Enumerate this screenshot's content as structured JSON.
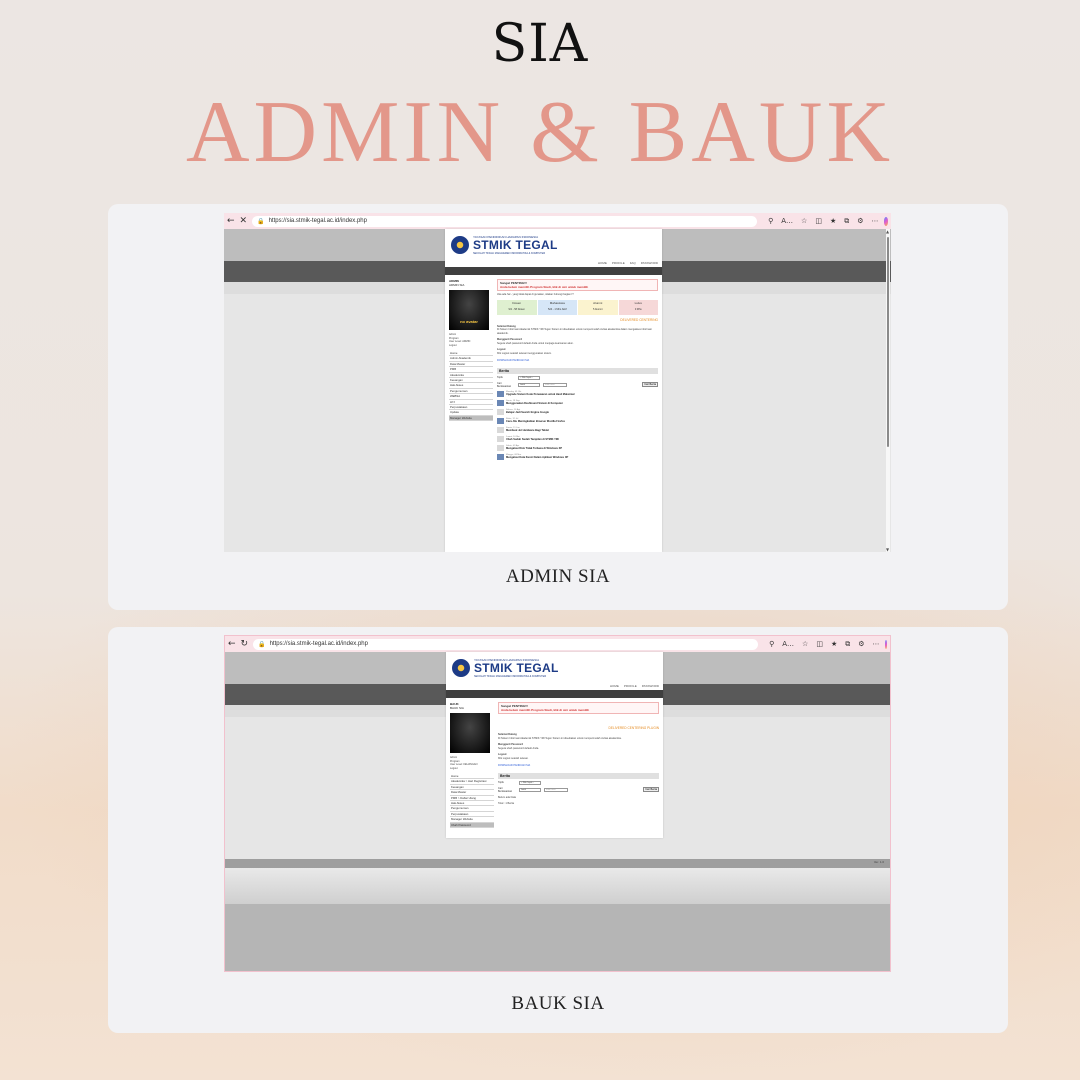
{
  "heading": {
    "small": "SIA",
    "large": "ADMIN & BAUK"
  },
  "colors": {
    "accent": "#e3978a",
    "card": "#f2f2f4",
    "tab_bar": "#f9e3e8"
  },
  "panels": [
    {
      "caption": "ADMIN SIA",
      "browser": {
        "url": "https://sia.stmik-tegal.ac.id/index.php",
        "toolbar_icons": [
          "back-icon",
          "close-icon",
          "lock-icon",
          "zoom-icon",
          "read-aloud-icon",
          "favorite-icon",
          "split-screen-icon",
          "favorites-bar-icon",
          "collections-icon",
          "extensions-icon",
          "more-icon",
          "copilot-icon"
        ]
      },
      "site": {
        "foundation": "YAYASAN PENDIDIKAN HARAPAN INDONESIA",
        "name": "STMIK TEGAL",
        "subtitle": "SEKOLAH TINGGI MANAJEMEN INFORMATIKA & KOMPUTER",
        "nav": [
          "HOME",
          "PROFILE",
          "FAQ",
          "PASSWORD"
        ],
        "user": {
          "role": "ADMIN",
          "name": "ADMIN SIA",
          "avatar_label": "no avatar",
          "meta": [
            "Admin",
            "Program",
            "User Level: ADMIN",
            "Logout"
          ]
        },
        "menu": [
          "Home",
          "Admin Akademik",
          "Data Master",
          "PMB",
          "Akademika",
          "Keuangan",
          "Hak Akses",
          "Pengumuman",
          "WEBSA",
          "LPJ",
          "Perpustakaan",
          "Update",
          "Manager Website"
        ],
        "alert_title": "Sangat PENTING!!!",
        "alert_text": "Anda belum memilih Program Studi, klik di sini untuk memilih",
        "notice": "Jika ada hal - yang tidak dapat di gunakan, silakan hubungi bagian IT",
        "stats": [
          {
            "label": "Dosen",
            "value": "9/2 - 58 Dosen",
            "color": "#dff0d0"
          },
          {
            "label": "Mahasiswa",
            "value": "524 - 1 Mhs Aktif",
            "color": "#d6e6f7"
          },
          {
            "label": "Alumni",
            "value": "5 Alumni",
            "color": "#fbf3cf"
          },
          {
            "label": "Lulus",
            "value": "0 Mhs",
            "color": "#f6d8d8"
          }
        ],
        "rss": "DELIVERED CENTERING",
        "sections": [
          {
            "title": "Selamat Datang",
            "text": "Di Sistem Informasi Akademik STMIK YMI Tegal. Sistem ini disediakan untuk mempermudah civitas akademika dalam mengakses informasi akademik."
          },
          {
            "title": "Mengganti Password",
            "text": "Segera ubah password default Anda untuk menjaga keamanan akun."
          },
          {
            "title": "Logout",
            "text": "Klik Logout setelah selesai menggunakan sistem."
          }
        ],
        "download": "DOWNLOAD PANDUAN SIA",
        "news_title": "Berita",
        "filter": {
          "label1": "Topik",
          "label2": "Cari Berdasarkan",
          "select1": "-- Pilih Topik --",
          "select2": "Judul",
          "placeholder": "Kata Kunci",
          "button": "Cari Berita"
        },
        "news": [
          {
            "date": "Monday, 09 Okt",
            "title": "Upgrade Sistem Kode Penawaran untuk Hasil Maksimal"
          },
          {
            "date": "Senin, 18 Sep",
            "title": "Menggunakan Dashboard Sistem di Komputer"
          },
          {
            "date": "Selasa, 16 Agt",
            "title": "Belajar Jadi Search Engine Google"
          },
          {
            "date": "Rabu, 12 Jul",
            "title": "Cara Jitu Meningkatkan Browser Mozilla Firefox"
          },
          {
            "date": "Kamis, 11 Jun",
            "title": "Membuat Jet Hardware Bagi Tablet"
          },
          {
            "date": "Jumat, 10 Mei",
            "title": "Ubah Sudah Sudah Tampilan di STMIK YMI"
          },
          {
            "date": "Sabtu, 09 Apr",
            "title": "Mengatasi Disk Tidak Terbaca di Windows XP"
          },
          {
            "date": "Minggu, 08 Mar",
            "title": "Mengatasi Kata Kunci Dalam Aplikasi Windows XP"
          }
        ]
      }
    },
    {
      "caption": "BAUK SIA",
      "browser": {
        "url": "https://sia.stmik-tegal.ac.id/index.php",
        "toolbar_icons": [
          "back-icon",
          "refresh-icon",
          "lock-icon",
          "zoom-icon",
          "read-aloud-icon",
          "favorite-icon",
          "split-screen-icon",
          "favorites-bar-icon",
          "collections-icon",
          "extensions-icon",
          "more-icon",
          "copilot-icon"
        ]
      },
      "site": {
        "foundation": "YAYASAN PENDIDIKAN HARAPAN INDONESIA",
        "name": "STMIK TEGAL",
        "subtitle": "SEKOLAH TINGGI MANAJEMEN INFORMATIKA & KOMPUTER",
        "nav": [
          "HOME",
          "PROFILE",
          "PASSWORD"
        ],
        "user": {
          "role": "BAUK",
          "name": "BAUK SIA",
          "meta": [
            "Admin",
            "Program",
            "User Level: KEUANGAN",
            "Logout"
          ]
        },
        "menu": [
          "Home",
          "Akademika > Hari Registrasi",
          "Keuangan",
          "Data Master",
          "PMB > Daftar Ulang",
          "Hak Akses",
          "Pengumuman",
          "Perpustakaan",
          "Manager Website",
          "Ubah Password"
        ],
        "alert_title": "Sangat PENTING!!!",
        "alert_text": "Anda belum memilih Program Studi, klik di sini untuk memilih",
        "rss": "DELIVERED CENTERING PLUGIN",
        "sections": [
          {
            "title": "Selamat Datang",
            "text": "Di Sistem Informasi Akademik STMIK YMI Tegal. Sistem ini disediakan untuk mempermudah civitas akademika."
          },
          {
            "title": "Mengganti Password",
            "text": "Segera ubah password default Anda."
          },
          {
            "title": "Logout",
            "text": "Klik Logout setelah selesai."
          }
        ],
        "download": "DOWNLOAD PANDUAN SIA",
        "news_title": "Berita",
        "filter": {
          "label1": "Topik",
          "label2": "Cari Berdasarkan",
          "select1": "-- Pilih Topik --",
          "select2": "Judul",
          "placeholder": "Kata Kunci",
          "button": "Cari Berita"
        },
        "empty": "Belum ada Data",
        "footer": "Total : 1 Berita",
        "version": "Ver. 1.0"
      }
    }
  ]
}
